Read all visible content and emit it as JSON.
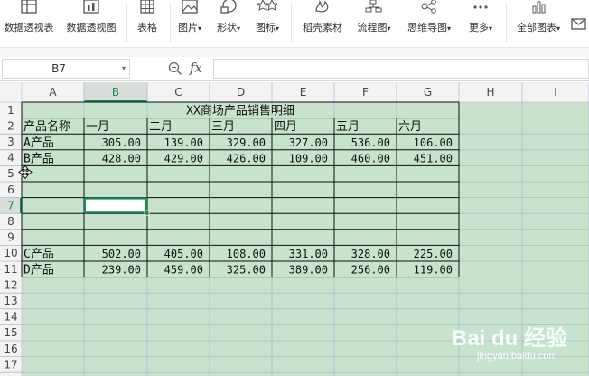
{
  "ribbon": {
    "items": [
      {
        "label": "数据透视表",
        "icon": "pivot-table-icon"
      },
      {
        "label": "数据透视图",
        "icon": "pivot-chart-icon"
      },
      {
        "label": "表格",
        "icon": "table-icon"
      },
      {
        "label": "图片",
        "icon": "picture-icon",
        "dropdown": "▾"
      },
      {
        "label": "形状",
        "icon": "shapes-icon",
        "dropdown": "▾"
      },
      {
        "label": "图标",
        "icon": "icons-icon",
        "dropdown": "▾"
      },
      {
        "label": "稻壳素材",
        "icon": "docer-material-icon"
      },
      {
        "label": "流程图",
        "icon": "flowchart-icon",
        "dropdown": "▾"
      },
      {
        "label": "思维导图",
        "icon": "mindmap-icon",
        "dropdown": "▾"
      },
      {
        "label": "更多",
        "icon": "more-icon",
        "dropdown": "▾"
      },
      {
        "label": "全部图表",
        "icon": "all-charts-icon",
        "dropdown": "▾"
      }
    ]
  },
  "formula_bar": {
    "name_box": "B7",
    "name_box_arrow": "▾",
    "zoom_icon": "zoom-icon",
    "fx": "fx",
    "formula": ""
  },
  "sheet": {
    "columns": [
      "A",
      "B",
      "C",
      "D",
      "E",
      "F",
      "G",
      "H",
      "I"
    ],
    "rows": [
      "1",
      "2",
      "3",
      "4",
      "5",
      "6",
      "7",
      "8",
      "9",
      "10",
      "11",
      "12",
      "13",
      "14",
      "15",
      "16",
      "17"
    ],
    "title": "XX商场产品销售明细",
    "header": [
      "产品名称",
      "一月",
      "二月",
      "三月",
      "四月",
      "五月",
      "六月"
    ],
    "data_rows": [
      {
        "row": 3,
        "cells": [
          "A产品",
          "305.00",
          "139.00",
          "329.00",
          "327.00",
          "536.00",
          "106.00"
        ]
      },
      {
        "row": 4,
        "cells": [
          "B产品",
          "428.00",
          "429.00",
          "426.00",
          "109.00",
          "460.00",
          "451.00"
        ]
      },
      {
        "row": 10,
        "cells": [
          "C产品",
          "502.00",
          "405.00",
          "108.00",
          "331.00",
          "328.00",
          "225.00"
        ]
      },
      {
        "row": 11,
        "cells": [
          "D产品",
          "239.00",
          "459.00",
          "325.00",
          "389.00",
          "256.00",
          "119.00"
        ]
      }
    ],
    "selected_cell": "B7",
    "fill_color": "#c7e3cc",
    "gridline_color": "#aab8d8",
    "selection_color": "#1a8a5a"
  },
  "watermark": {
    "text": "Bai du 经验",
    "url": "jingyan.baidu.com"
  }
}
